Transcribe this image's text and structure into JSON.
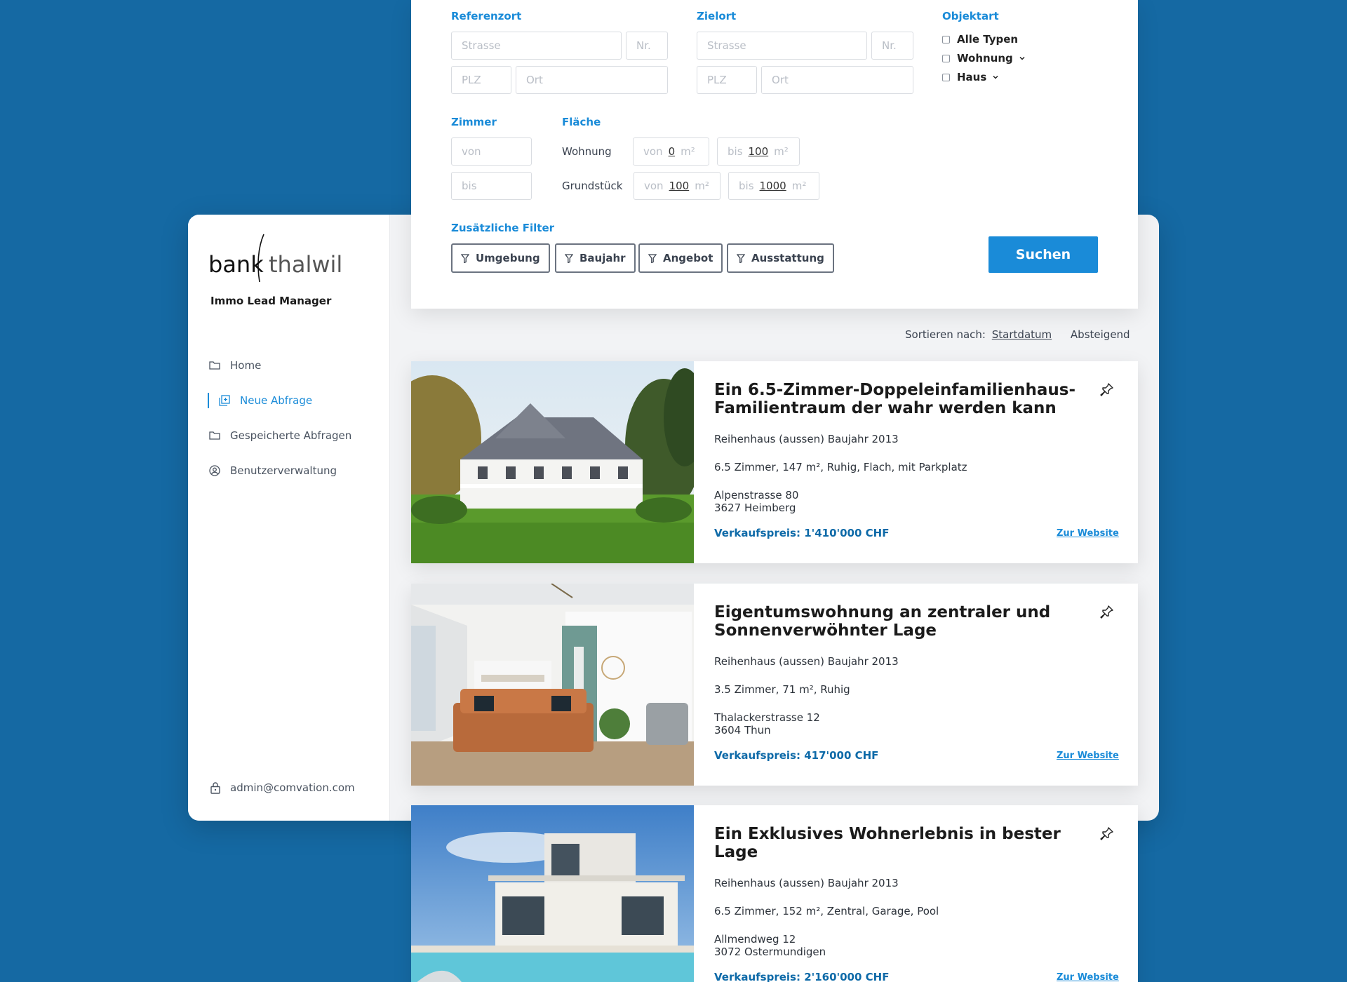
{
  "brand": {
    "logo_text_left": "bank",
    "logo_text_right": "thalwil",
    "app_name": "Immo Lead Manager"
  },
  "nav": {
    "items": [
      {
        "label": "Home",
        "icon": "folder-icon"
      },
      {
        "label": "Neue Abfrage",
        "icon": "add-query-icon",
        "active": true
      },
      {
        "label": "Gespeicherte Abfragen",
        "icon": "folder-icon"
      },
      {
        "label": "Benutzerverwaltung",
        "icon": "user-circle-icon"
      }
    ]
  },
  "account": {
    "email": "admin@comvation.com"
  },
  "filters": {
    "referenzort": {
      "label": "Referenzort",
      "street_placeholder": "Strasse",
      "number_placeholder": "Nr.",
      "zip_placeholder": "PLZ",
      "city_placeholder": "Ort"
    },
    "zielort": {
      "label": "Zielort",
      "street_placeholder": "Strasse",
      "number_placeholder": "Nr.",
      "zip_placeholder": "PLZ",
      "city_placeholder": "Ort"
    },
    "objektart": {
      "label": "Objektart",
      "options": [
        "Alle Typen",
        "Wohnung",
        "Haus"
      ]
    },
    "zimmer": {
      "label": "Zimmer",
      "from_placeholder": "von",
      "to_placeholder": "bis"
    },
    "flaeche": {
      "label": "Fläche",
      "wohnung": {
        "label": "Wohnung",
        "from_prefix": "von",
        "from_value": "0",
        "to_prefix": "bis",
        "to_value": "100",
        "unit": "m²"
      },
      "grundstueck": {
        "label": "Grundstück",
        "from_prefix": "von",
        "from_value": "100",
        "to_prefix": "bis",
        "to_value": "1000",
        "unit": "m²"
      }
    },
    "extra": {
      "label": "Zusätzliche Filter",
      "buttons": [
        "Umgebung",
        "Baujahr",
        "Angebot",
        "Ausstattung"
      ]
    },
    "search_label": "Suchen"
  },
  "sort": {
    "prefix": "Sortieren nach:",
    "field": "Startdatum",
    "direction": "Absteigend"
  },
  "listings": [
    {
      "title": "Ein 6.5-Zimmer-Doppeleinfamilienhaus-Familientraum der wahr werden kann",
      "subtitle": "Reihenhaus (aussen) Baujahr 2013",
      "details": "6.5 Zimmer, 147 m², Ruhig, Flach, mit Parkplatz",
      "street": "Alpenstrasse 80",
      "city": "3627 Heimberg",
      "price": "Verkaufspreis: 1'410'000 CHF",
      "link": "Zur Website"
    },
    {
      "title": "Eigentumswohnung an zentraler und Sonnenverwöhnter Lage",
      "subtitle": "Reihenhaus (aussen) Baujahr 2013",
      "details": "3.5 Zimmer, 71 m², Ruhig",
      "street": "Thalackerstrasse 12",
      "city": "3604 Thun",
      "price": "Verkaufspreis: 417'000 CHF",
      "link": "Zur Website"
    },
    {
      "title": "Ein Exklusives Wohnerlebnis in bester Lage",
      "subtitle": "Reihenhaus (aussen) Baujahr 2013",
      "details": "6.5 Zimmer, 152 m², Zentral, Garage, Pool",
      "street": "Allmendweg 12",
      "city": "3072 Ostermundigen",
      "price": "Verkaufspreis: 2'160'000 CHF",
      "link": "Zur Website"
    }
  ],
  "colors": {
    "background": "#1569a3",
    "accent": "#1a8bd8",
    "price": "#0e6aa8"
  }
}
